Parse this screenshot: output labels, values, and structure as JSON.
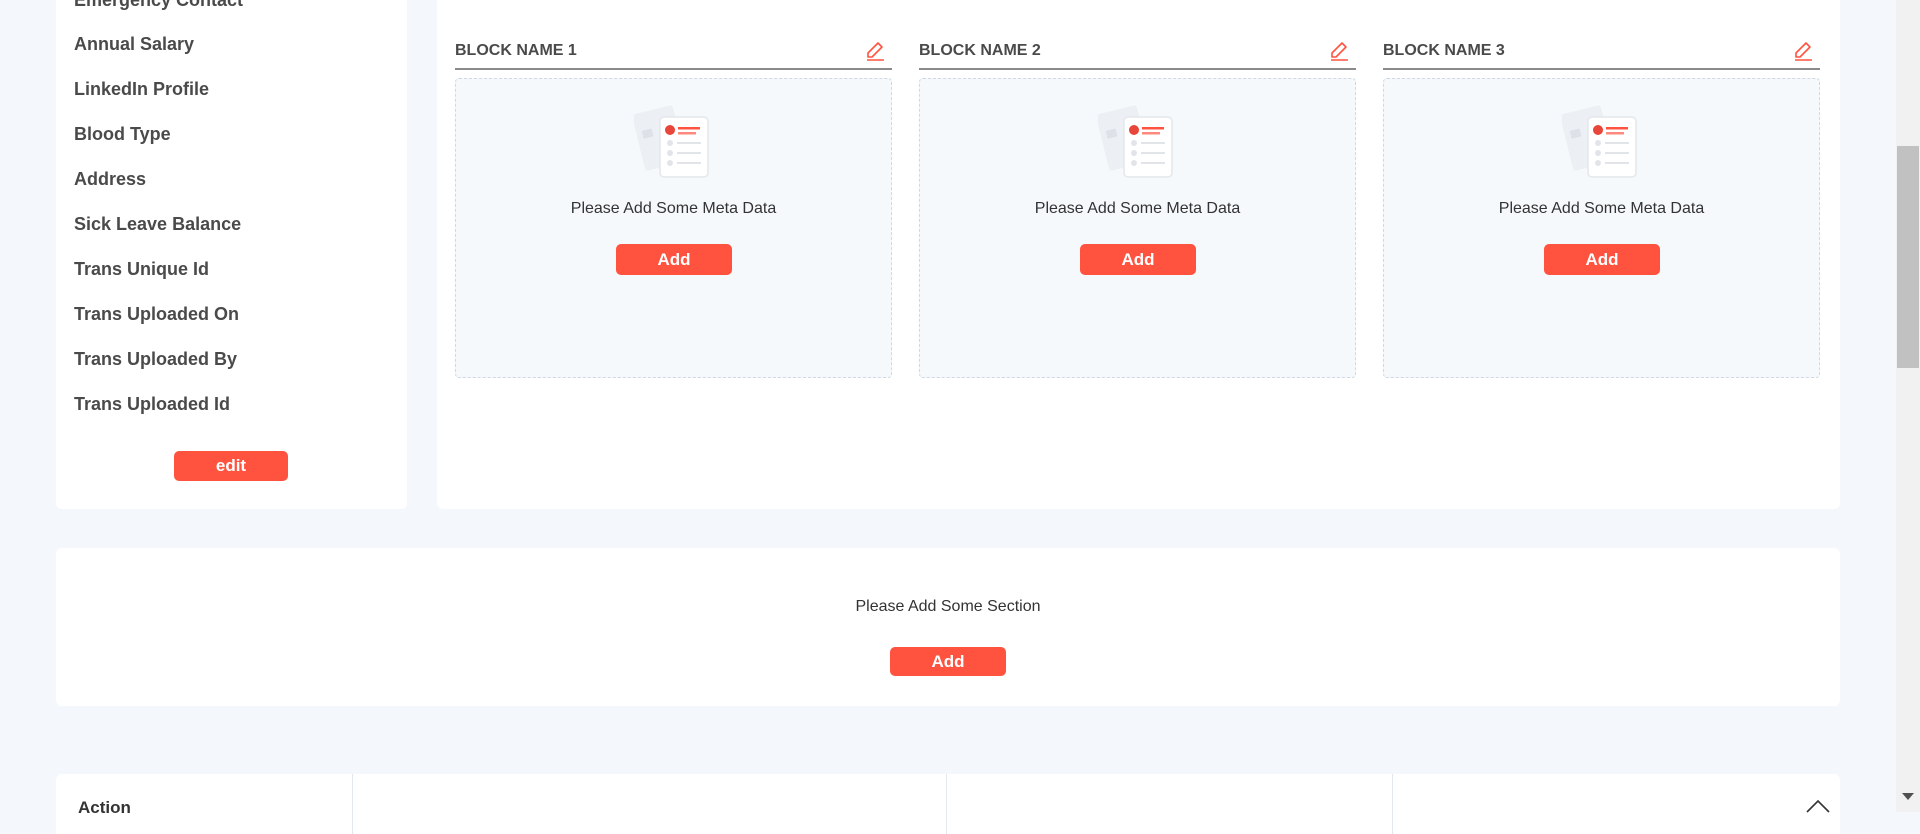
{
  "sidebar": {
    "items": [
      {
        "label": "Emergency Contact"
      },
      {
        "label": "Annual Salary"
      },
      {
        "label": "LinkedIn Profile"
      },
      {
        "label": "Blood Type"
      },
      {
        "label": "Address"
      },
      {
        "label": "Sick Leave Balance"
      },
      {
        "label": "Trans Unique Id"
      },
      {
        "label": "Trans Uploaded On"
      },
      {
        "label": "Trans Uploaded By"
      },
      {
        "label": "Trans Uploaded Id"
      }
    ],
    "edit_label": "edit"
  },
  "blocks": [
    {
      "title": "BLOCK NAME 1",
      "empty_text": "Please Add Some Meta Data",
      "add_label": "Add"
    },
    {
      "title": "BLOCK NAME 2",
      "empty_text": "Please Add Some Meta Data",
      "add_label": "Add"
    },
    {
      "title": "BLOCK NAME 3",
      "empty_text": "Please Add Some Meta Data",
      "add_label": "Add"
    }
  ],
  "section": {
    "empty_text": "Please Add Some Section",
    "add_label": "Add"
  },
  "action": {
    "label": "Action"
  },
  "colors": {
    "accent": "#ff5340",
    "background": "#f4f7fb"
  },
  "icons": [
    "pencil-icon",
    "document-illustration-icon",
    "chevron-up-icon"
  ]
}
